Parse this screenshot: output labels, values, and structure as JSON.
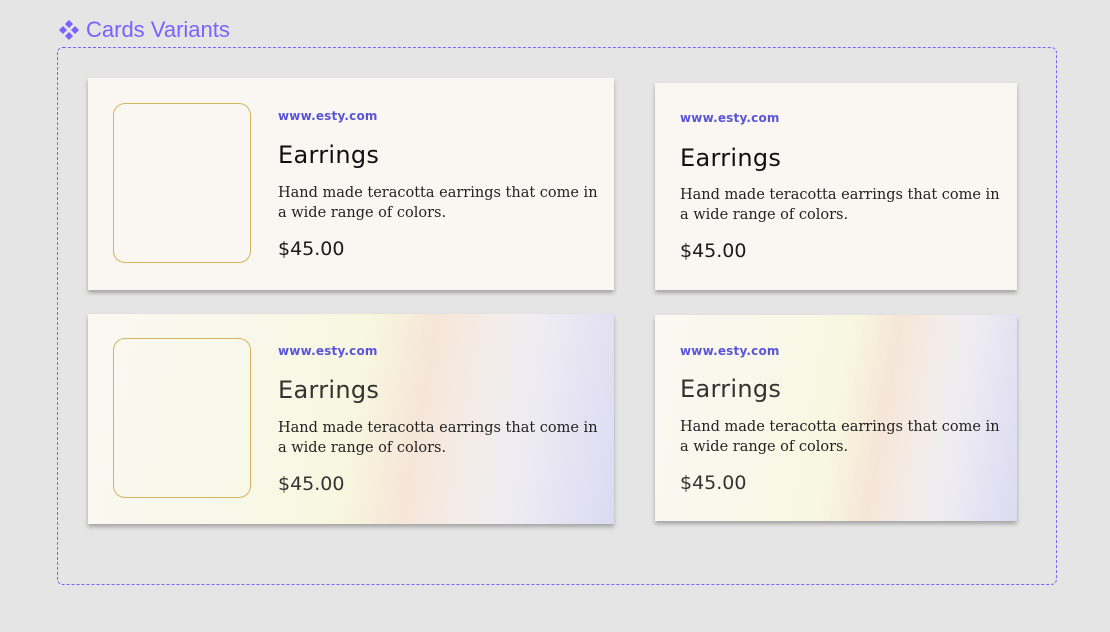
{
  "frame": {
    "label": "Cards Variants",
    "icon": "component-icon",
    "accent_color": "#7b61ff"
  },
  "cards": [
    {
      "variant": "with-image",
      "style": "plain",
      "url": "www.esty.com",
      "title": "Earrings",
      "description": "Hand made teracotta earrings that come in a wide range of colors.",
      "price": "$45.00"
    },
    {
      "variant": "text-only",
      "style": "plain",
      "url": "www.esty.com",
      "title": "Earrings",
      "description": "Hand made teracotta earrings that come in a wide range of colors.",
      "price": "$45.00"
    },
    {
      "variant": "with-image",
      "style": "gradient",
      "url": "www.esty.com",
      "title": "Earrings",
      "description": "Hand made teracotta earrings that come in a wide range of colors.",
      "price": "$45.00"
    },
    {
      "variant": "text-only",
      "style": "gradient",
      "url": "www.esty.com",
      "title": "Earrings",
      "description": "Hand made teracotta earrings that come in a wide range of colors.",
      "price": "$45.00"
    }
  ],
  "colors": {
    "url": "#5a55d8",
    "thumb_border": "#d4b55e",
    "card_bg": "#faf7f2",
    "canvas_bg": "#e5e5e5"
  }
}
